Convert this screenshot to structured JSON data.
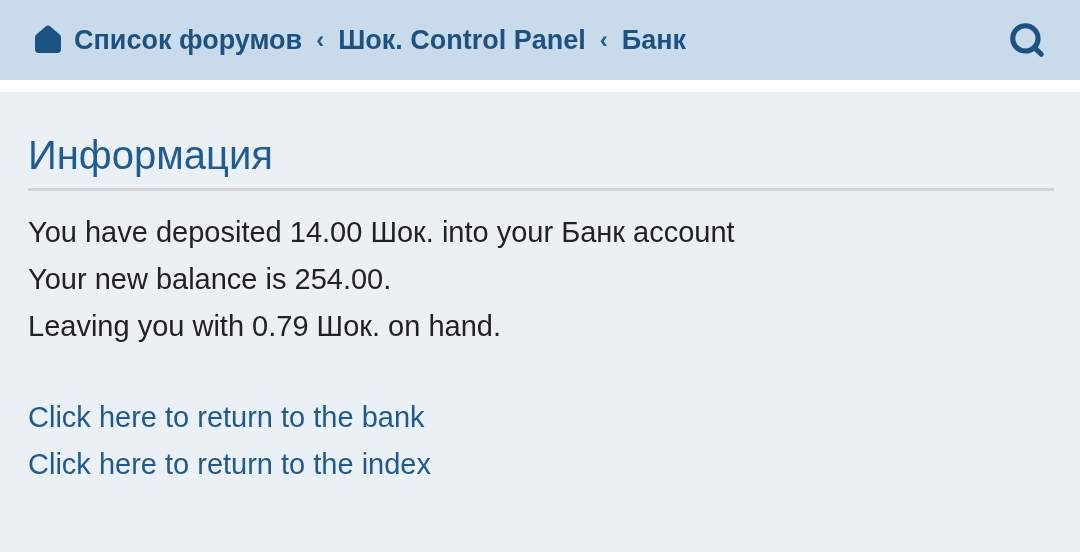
{
  "breadcrumbs": [
    {
      "label": "Список форумов",
      "kind": "home"
    },
    {
      "label": "Шок. Control Panel",
      "kind": "crumb"
    },
    {
      "label": "Банк",
      "kind": "crumb"
    }
  ],
  "separator": "‹",
  "title": "Информация",
  "messages": [
    "You have deposited 14.00 Шок. into your Банк account",
    "Your new balance is 254.00.",
    "Leaving you with 0.79 Шок. on hand."
  ],
  "links": [
    "Click here to return to the bank",
    "Click here to return to the index"
  ]
}
